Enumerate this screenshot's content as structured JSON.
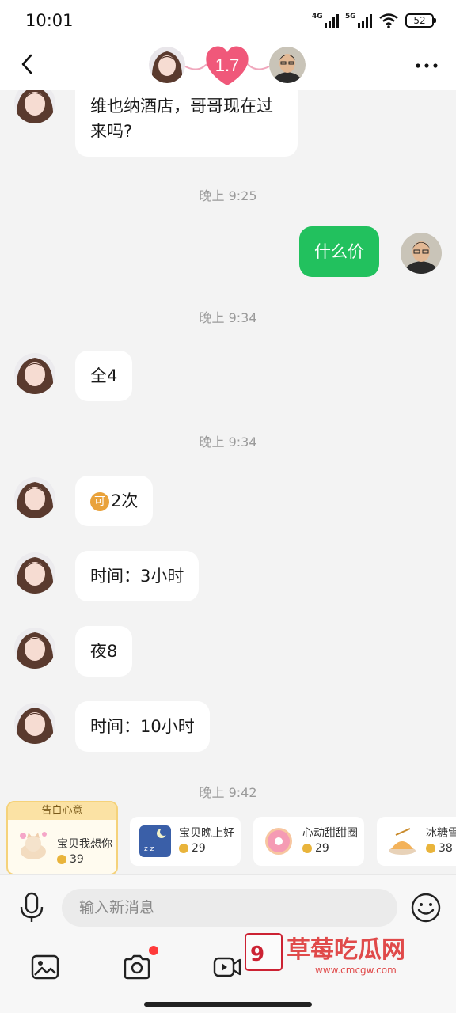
{
  "status_bar": {
    "time": "10:01",
    "net1": "4G",
    "net2": "5G",
    "battery": "52"
  },
  "header": {
    "intimacy": "1.7"
  },
  "messages": [
    {
      "sender": "her",
      "text_line1": "维也纳酒店，哥哥现在过",
      "text_line2": "来吗?"
    },
    {
      "timestamp": "晚上 9:25"
    },
    {
      "sender": "me",
      "text": "什么价"
    },
    {
      "timestamp": "晚上 9:34"
    },
    {
      "sender": "her",
      "text": "全4"
    },
    {
      "timestamp": "晚上 9:34"
    },
    {
      "sender": "her",
      "coin_glyph": "可",
      "text": "2次"
    },
    {
      "sender": "her",
      "text": "时间：3小时"
    },
    {
      "sender": "her",
      "text": "夜8"
    },
    {
      "sender": "her",
      "text": "时间：10小时"
    },
    {
      "timestamp": "晚上 9:42"
    }
  ],
  "gifts": {
    "featured_tag": "告白心意",
    "items": [
      {
        "name": "宝贝我想你",
        "price": "39"
      },
      {
        "name": "宝贝晚上好",
        "price": "29"
      },
      {
        "name": "心动甜甜圈",
        "price": "29"
      },
      {
        "name": "冰糖雪",
        "price": "38"
      }
    ]
  },
  "input": {
    "placeholder": "输入新消息"
  },
  "watermark": {
    "text": "草莓吃瓜网",
    "url": "www.cmcgw.com"
  },
  "colors": {
    "my_bubble": "#22c15e",
    "heart": "#f0587a",
    "notify_dot": "#ff3a3a"
  }
}
